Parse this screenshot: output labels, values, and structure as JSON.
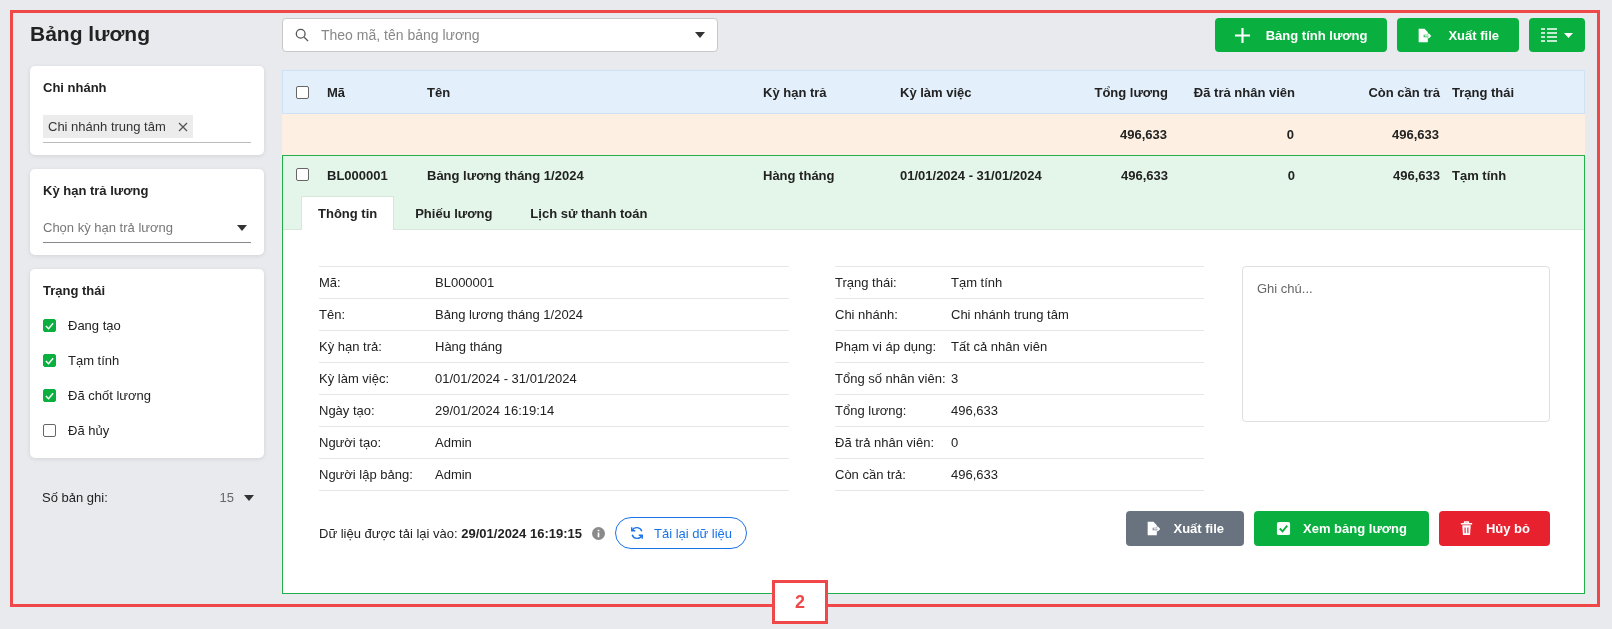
{
  "page_title": "Bảng lương",
  "search": {
    "placeholder": "Theo mã, tên bảng lương"
  },
  "toolbar": [
    {
      "kind": "add",
      "label": "Bảng tính lương"
    },
    {
      "kind": "export",
      "label": "Xuất file"
    },
    {
      "kind": "view-menu"
    }
  ],
  "filters": {
    "branch": {
      "title": "Chi nhánh",
      "tags": [
        "Chi nhánh trung tâm"
      ]
    },
    "pay_period": {
      "title": "Kỳ hạn trả lương",
      "placeholder": "Chọn kỳ hạn trả lương"
    },
    "status": {
      "title": "Trạng thái",
      "options": [
        {
          "label": "Đang tạo",
          "checked": true
        },
        {
          "label": "Tạm tính",
          "checked": true
        },
        {
          "label": "Đã chốt lương",
          "checked": true
        },
        {
          "label": "Đã hủy",
          "checked": false
        }
      ]
    },
    "records": {
      "label": "Số bản ghi:",
      "value": "15"
    }
  },
  "table": {
    "all_checked": false,
    "columns": [
      {
        "label": "Mã",
        "kind": "text"
      },
      {
        "label": "Tên",
        "kind": "text"
      },
      {
        "label": "Kỳ hạn trả",
        "kind": "text"
      },
      {
        "label": "Kỳ làm việc",
        "kind": "text"
      },
      {
        "label": "Tổng lương",
        "kind": "amount"
      },
      {
        "label": "Đã trả nhân viên",
        "kind": "amount"
      },
      {
        "label": "Còn cần trả",
        "kind": "amount"
      },
      {
        "label": "Trạng thái",
        "kind": "text"
      }
    ],
    "summary": {
      "total_salary": "496,633",
      "paid_to_employees": "0",
      "remaining": "496,633"
    },
    "rows": [
      {
        "checked": false,
        "expanded": true,
        "cells": [
          "BL000001",
          "Bảng lương tháng 1/2024",
          "Hàng tháng",
          "01/01/2024 - 31/01/2024",
          "496,633",
          "0",
          "496,633",
          "Tạm tính"
        ]
      }
    ]
  },
  "detail": {
    "tabs": [
      {
        "label": "Thông tin",
        "selected": true
      },
      {
        "label": "Phiếu lương",
        "selected": false
      },
      {
        "label": "Lịch sử thanh toán",
        "selected": false
      }
    ],
    "info_left": [
      {
        "label": "Mã:",
        "value": "BL000001"
      },
      {
        "label": "Tên:",
        "value": "Bảng lương tháng 1/2024"
      },
      {
        "label": "Kỳ hạn trả:",
        "value": "Hàng tháng"
      },
      {
        "label": "Kỳ làm việc:",
        "value": "01/01/2024 - 31/01/2024"
      },
      {
        "label": "Ngày tạo:",
        "value": "29/01/2024 16:19:14"
      },
      {
        "label": "Người tạo:",
        "value": "Admin"
      },
      {
        "label": "Người lập bảng:",
        "value": "Admin"
      }
    ],
    "info_right": [
      {
        "label": "Trạng thái:",
        "value": "Tạm tính"
      },
      {
        "label": "Chi nhánh:",
        "value": "Chi nhánh trung tâm"
      },
      {
        "label": "Phạm vi áp dụng:",
        "value": "Tất cả nhân viên"
      },
      {
        "label": "Tổng số nhân viên:",
        "value": "3"
      },
      {
        "label": "Tổng lương:",
        "value": "496,633"
      },
      {
        "label": "Đã trả nhân viên:",
        "value": "0"
      },
      {
        "label": "Còn cần trả:",
        "value": "496,633"
      }
    ],
    "note": {
      "placeholder": "Ghi chú..."
    },
    "reload_text": "Dữ liệu được tải lại vào: **29/01/2024 16:19:15**",
    "reload_button": "Tải lại dữ liệu",
    "actions": [
      {
        "kind": "export",
        "label": "Xuất file"
      },
      {
        "kind": "view",
        "label": "Xem bảng lương"
      },
      {
        "kind": "cancel",
        "label": "Hủy bỏ"
      }
    ]
  },
  "annotation": {
    "label": "2"
  }
}
